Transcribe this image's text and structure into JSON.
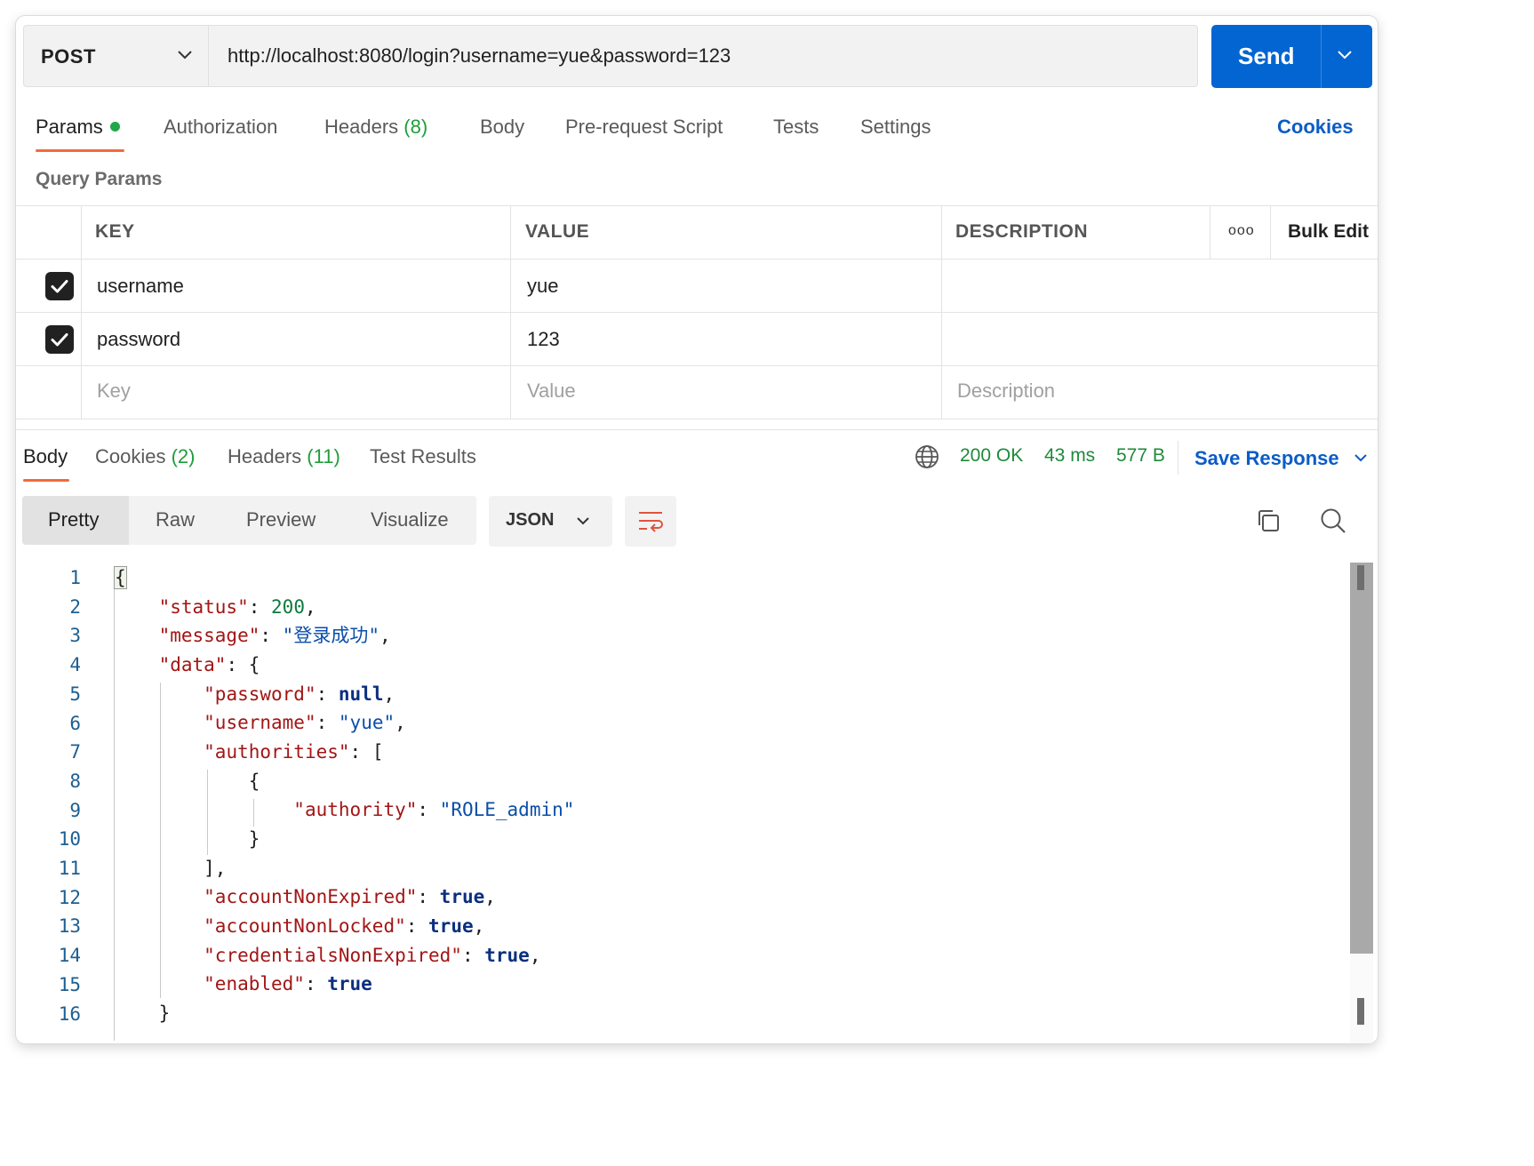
{
  "request": {
    "method": "POST",
    "url": "http://localhost:8080/login?username=yue&password=123",
    "send_label": "Send"
  },
  "request_tabs": {
    "params": "Params",
    "authorization": "Authorization",
    "headers": "Headers",
    "headers_count": "(8)",
    "body": "Body",
    "pre_request": "Pre-request Script",
    "tests": "Tests",
    "settings": "Settings",
    "cookies": "Cookies"
  },
  "query_params": {
    "title": "Query Params",
    "columns": {
      "key": "KEY",
      "value": "VALUE",
      "description": "DESCRIPTION",
      "bulk_edit": "Bulk Edit"
    },
    "rows": [
      {
        "key": "username",
        "value": "yue",
        "description": "",
        "checked": true
      },
      {
        "key": "password",
        "value": "123",
        "description": "",
        "checked": true
      }
    ],
    "placeholders": {
      "key": "Key",
      "value": "Value",
      "description": "Description"
    }
  },
  "response_tabs": {
    "body": "Body",
    "cookies": "Cookies",
    "cookies_count": "(2)",
    "headers": "Headers",
    "headers_count": "(11)",
    "test_results": "Test Results"
  },
  "response_meta": {
    "status": "200 OK",
    "time": "43 ms",
    "size": "577 B",
    "save_response": "Save Response"
  },
  "view_modes": {
    "pretty": "Pretty",
    "raw": "Raw",
    "preview": "Preview",
    "visualize": "Visualize"
  },
  "format": "JSON",
  "code": {
    "line_numbers": [
      "1",
      "2",
      "3",
      "4",
      "5",
      "6",
      "7",
      "8",
      "9",
      "10",
      "11",
      "12",
      "13",
      "14",
      "15",
      "16"
    ],
    "body": {
      "status": 200,
      "message": "登录成功",
      "data": {
        "password": null,
        "username": "yue",
        "authorities": [
          {
            "authority": "ROLE_admin"
          }
        ],
        "accountNonExpired": true,
        "accountNonLocked": true,
        "credentialsNonExpired": true,
        "enabled": true
      }
    }
  },
  "colors": {
    "accent": "#f26b3a",
    "send_button": "#0265d2",
    "link": "#0b5cc7",
    "status_green": "#1e8a3a",
    "json_key": "#a31515",
    "json_string": "#0b4ea8",
    "json_number": "#0e7a3d",
    "json_keyword": "#0b2f80"
  },
  "icons": [
    "chevron-down-icon",
    "checkbox-checked-icon",
    "more-icon",
    "globe-icon",
    "wrap-lines-icon",
    "copy-icon",
    "search-icon"
  ]
}
